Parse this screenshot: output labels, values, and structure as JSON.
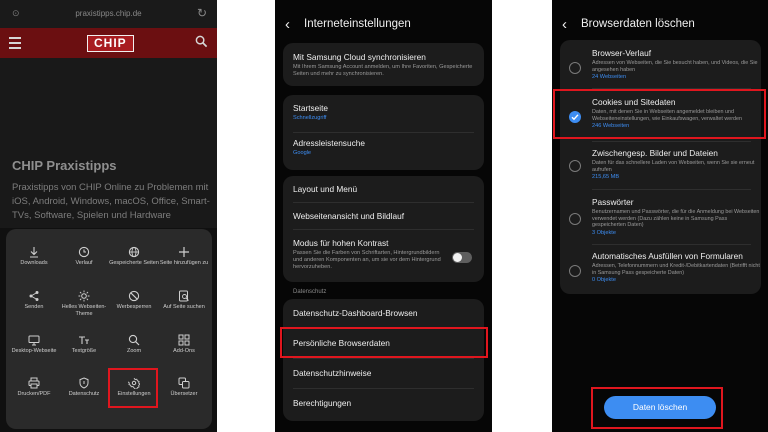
{
  "panel1": {
    "url": "praxistipps.chip.de",
    "logo": "CHIP",
    "hero_title": "CHIP Praxistipps",
    "hero_text": "Praxistipps von CHIP Online zu Problemen mit iOS, Android, Windows, macOS, Office, Smart-TVs, Software, Spielen und Hardware",
    "menu": [
      {
        "label": "Downloads",
        "icon": "download-icon"
      },
      {
        "label": "Verlauf",
        "icon": "clock-icon"
      },
      {
        "label": "Gespeicherte Seiten",
        "icon": "globe-icon"
      },
      {
        "label": "Seite hinzufügen zu",
        "icon": "plus-icon"
      },
      {
        "label": "Senden",
        "icon": "share-icon"
      },
      {
        "label": "Helles Webseiten-Theme",
        "icon": "sun-icon"
      },
      {
        "label": "Werbesperren",
        "icon": "block-icon"
      },
      {
        "label": "Auf Seite suchen",
        "icon": "find-in-page-icon"
      },
      {
        "label": "Desktop-Webseite",
        "icon": "desktop-icon"
      },
      {
        "label": "Textgröße",
        "icon": "text-size-icon"
      },
      {
        "label": "Zoom",
        "icon": "zoom-icon"
      },
      {
        "label": "Add-Ons",
        "icon": "addons-icon"
      },
      {
        "label": "Drucken/PDF",
        "icon": "print-icon"
      },
      {
        "label": "Datenschutz",
        "icon": "shield-icon"
      },
      {
        "label": "Einstellungen",
        "icon": "gear-icon"
      },
      {
        "label": "Übersetzer",
        "icon": "translate-icon"
      }
    ]
  },
  "panel2": {
    "title": "Interneteinstellungen",
    "sync_title": "Mit Samsung Cloud synchronisieren",
    "sync_sub": "Mit Ihrem Samsung Account anmelden, um Ihre Favoriten, Gespeicherte Seiten und mehr zu synchronisieren.",
    "home_title": "Startseite",
    "home_value": "Schnellzugriff",
    "search_title": "Adressleistensuche",
    "search_value": "Google",
    "layout": "Layout und Menü",
    "view": "Webseitenansicht und Bildlauf",
    "contrast_title": "Modus für hohen Kontrast",
    "contrast_sub": "Passen Sie die Farben von Schriftarten, Hintergrundbildern und anderen Komponenten an, um sie vor dem Hintergrund hervorzuheben.",
    "section": "Datenschutz",
    "dashboard": "Datenschutz-Dashboard-Browsen",
    "personal": "Persönliche Browserdaten",
    "notices": "Datenschutzhinweise",
    "permissions": "Berechtigungen"
  },
  "panel3": {
    "title": "Browserdaten löschen",
    "items": [
      {
        "title": "Browser-Verlauf",
        "sub": "Adressen von Webseiten, die Sie besucht haben, und Videos, die Sie angesehen haben",
        "value": "24 Webseiten",
        "checked": false
      },
      {
        "title": "Cookies und Sitedaten",
        "sub": "Daten, mit denen Sie in Webseiten angemeldet bleiben und Webseiteneinstellungen, wie Einkaufswagen, verwaltet werden",
        "value": "246 Webseiten",
        "checked": true
      },
      {
        "title": "Zwischengesp. Bilder und Dateien",
        "sub": "Daten für das schnellere Laden von Webseiten, wenn Sie sie erneut aufrufen",
        "value": "215,65 MB",
        "checked": false
      },
      {
        "title": "Passwörter",
        "sub": "Benutzernamen und Passwörter, die für die Anmeldung bei Webseiten verwendet werden (Dazu zählen keine in Samsung Pass gespeicherten Daten)",
        "value": "3 Objekte",
        "checked": false
      },
      {
        "title": "Automatisches Ausfüllen von Formularen",
        "sub": "Adressen, Telefonnummern und Kredit-/Debitkartendaten (Betrifft nicht in Samsung Pass gespeicherte Daten)",
        "value": "0 Objekte",
        "checked": false
      }
    ],
    "delete_button": "Daten löschen"
  },
  "colors": {
    "accent": "#3d8df2",
    "highlight": "#e0161e",
    "chip_red": "#a81c20"
  }
}
